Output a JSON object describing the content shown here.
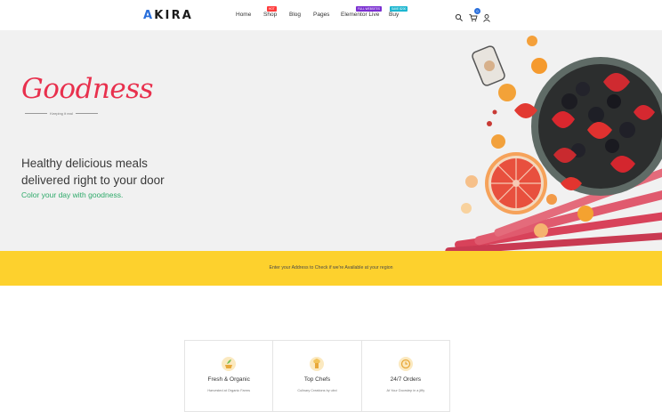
{
  "header": {
    "logo_accent": "A",
    "logo_rest": "KIRA",
    "nav": [
      {
        "label": "Home",
        "badge": ""
      },
      {
        "label": "Shop",
        "badge": "HOT"
      },
      {
        "label": "Blog",
        "badge": ""
      },
      {
        "label": "Pages",
        "badge": ""
      },
      {
        "label": "Elementor Live",
        "badge": "FULL WEBSITES"
      },
      {
        "label": "Buy",
        "badge": "SAVE $200"
      }
    ],
    "badge_colors": {
      "hot": "#ff3b3b",
      "full": "#7a2fd1",
      "save": "#1cb6d0"
    },
    "icons": [
      "search-icon",
      "cart-icon",
      "user-icon"
    ],
    "cart_count": "0"
  },
  "hero": {
    "brand": "Goodness",
    "tagline": "Keeping it real",
    "headline": "Healthy delicious meals delivered right to your door",
    "subline": "Color your day with goodness."
  },
  "address_bar": {
    "text": "Enter your Address to Check if we're Available at your region"
  },
  "features": [
    {
      "title": "Fresh & Organic",
      "desc": "Harvested at Organic Farms",
      "icon": "leaf-basket-icon"
    },
    {
      "title": "Top Chefs",
      "desc": "Culinary Creations by ubxi",
      "icon": "chef-icon"
    },
    {
      "title": "24/7 Orders",
      "desc": "At Your Doorstep in a jiffy",
      "icon": "clock-delivery-icon"
    }
  ],
  "colors": {
    "accent": "#2a6fdb",
    "brand_red": "#e8304d",
    "green": "#2faa6a",
    "yellow": "#fdd12d"
  }
}
